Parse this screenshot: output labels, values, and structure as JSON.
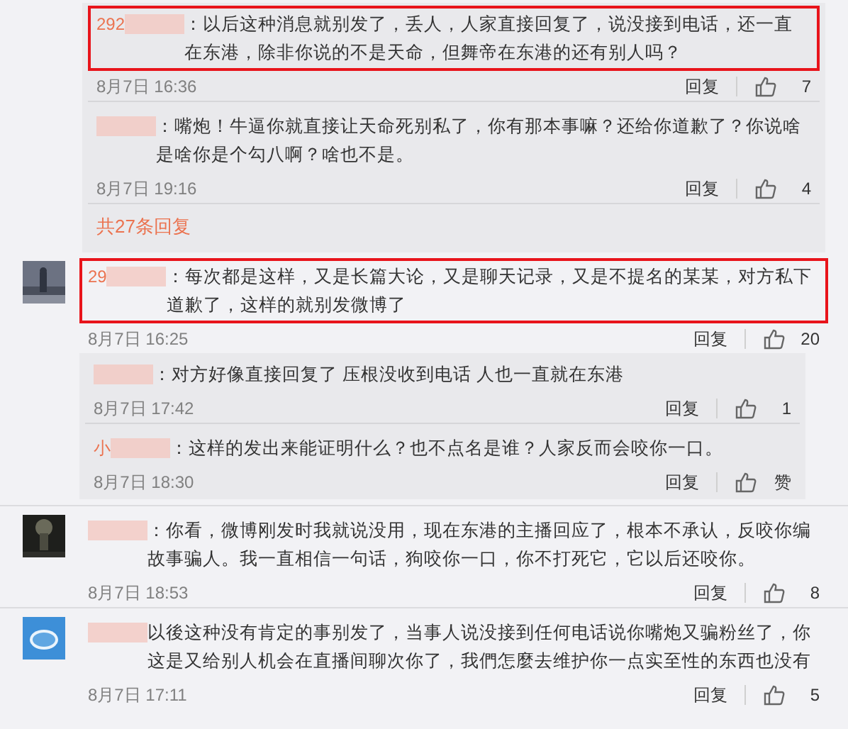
{
  "top_thread": {
    "replies": [
      {
        "name": "292",
        "text": "：以后这种消息就别发了，丢人，人家直接回复了，说没接到电话，还一直在东港，除非你说的不是天命，但舞帝在东港的还有别人吗？",
        "highlighted": true,
        "date": "8月7日 16:36",
        "reply": "回复",
        "likes": "7"
      },
      {
        "text": "：嘴炮！牛逼你就直接让天命死别私了，你有那本事嘛？还给你道歉了？你说啥是啥你是个勾八啊？啥也不是。",
        "highlighted": false,
        "date": "8月7日 19:16",
        "reply": "回复",
        "likes": "4"
      }
    ],
    "more": "共27条回复"
  },
  "comments": [
    {
      "name": "29",
      "text": "：每次都是这样，又是长篇大论，又是聊天记录，又是不提名的某某，对方私下道歉了，这样的就别发微博了",
      "highlighted": true,
      "date": "8月7日 16:25",
      "reply": "回复",
      "likes": "20",
      "replies": [
        {
          "text": "：对方好像直接回复了  压根没收到电话 人也一直就在东港",
          "highlighted": false,
          "date": "8月7日 17:42",
          "reply": "回复",
          "likes": "1"
        },
        {
          "name": "小",
          "text": "：这样的发出来能证明什么？也不点名是谁？人家反而会咬你一口。",
          "highlighted": false,
          "date": "8月7日 18:30",
          "reply": "回复",
          "likes": "赞"
        }
      ]
    },
    {
      "text": "：你看，微博刚发时我就说没用，现在东港的主播回应了，根本不承认，反咬你编故事骗人。我一直相信一句话，狗咬你一口，你不打死它，它以后还咬你。",
      "highlighted": false,
      "date": "8月7日 18:53",
      "reply": "回复",
      "likes": "8"
    },
    {
      "text": "以後这种没有肯定的事别发了，当事人说没接到任何电话说你嘴炮又骗粉丝了，你这是又给别人机会在直播间聊次你了，我們怎麼去维护你一点实至性的东西也没有",
      "highlighted": false,
      "date": "8月7日 17:11",
      "reply": "回复",
      "likes": "5"
    }
  ]
}
